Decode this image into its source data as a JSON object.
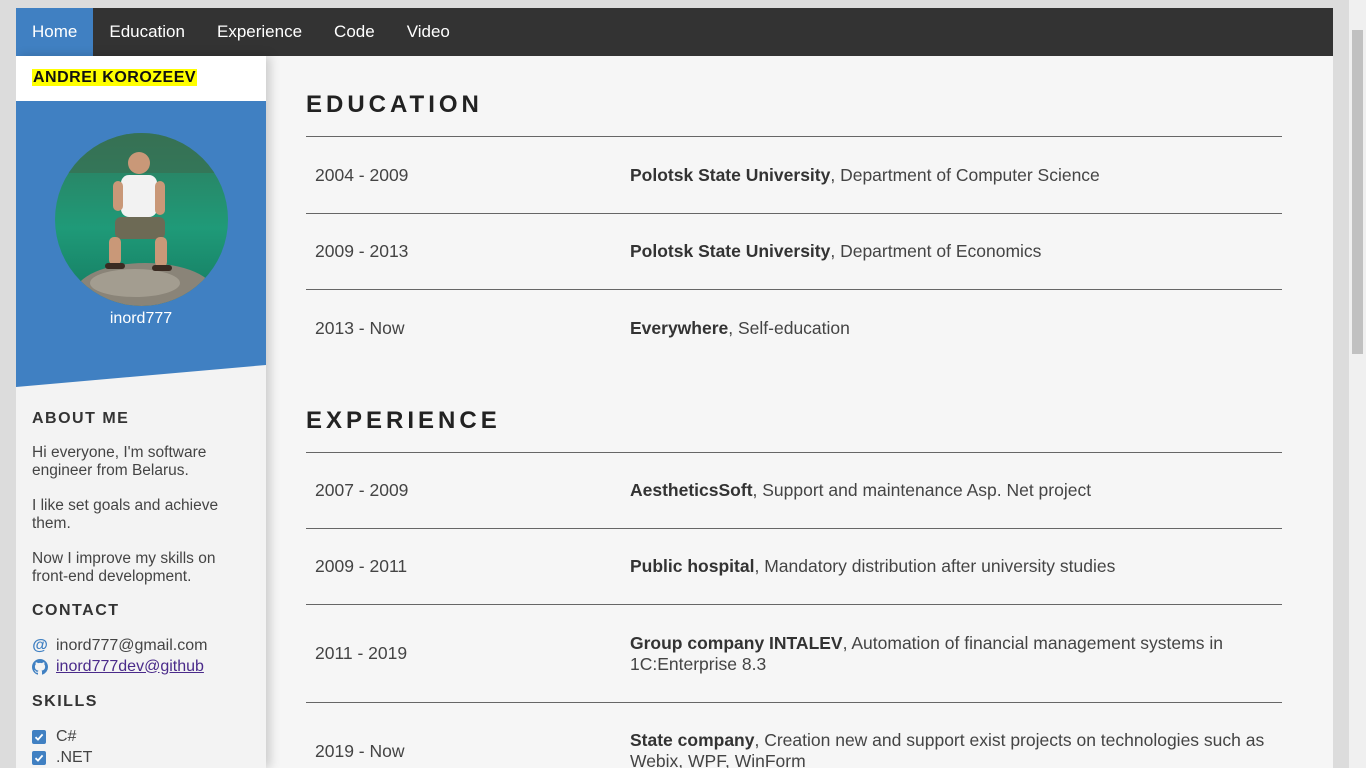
{
  "nav": {
    "items": [
      {
        "label": "Home",
        "active": true
      },
      {
        "label": "Education",
        "active": false
      },
      {
        "label": "Experience",
        "active": false
      },
      {
        "label": "Code",
        "active": false
      },
      {
        "label": "Video",
        "active": false
      }
    ]
  },
  "sidebar": {
    "name": "ANDREI KOROZEEV",
    "username": "inord777",
    "about": {
      "heading": "ABOUT ME",
      "paragraphs": [
        "Hi everyone, I'm software engineer from Belarus.",
        "I like set goals and achieve them.",
        "Now I improve my skills on front-end development."
      ]
    },
    "contact": {
      "heading": "CONTACT",
      "email": "inord777@gmail.com",
      "github": "inord777dev@github",
      "email_icon": "at-icon",
      "github_icon": "github-icon"
    },
    "skills": {
      "heading": "SKILLS",
      "items": [
        "C#",
        ".NET"
      ]
    }
  },
  "education": {
    "heading": "EDUCATION",
    "rows": [
      {
        "years": "2004 - 2009",
        "org": "Polotsk State University",
        "detail": ", Department of Computer Science"
      },
      {
        "years": "2009 - 2013",
        "org": "Polotsk State University",
        "detail": ", Department of Economics"
      },
      {
        "years": "2013 - Now",
        "org": "Everywhere",
        "detail": ", Self-education"
      }
    ]
  },
  "experience": {
    "heading": "EXPERIENCE",
    "rows": [
      {
        "years": "2007 - 2009",
        "org": "AestheticsSoft",
        "detail": ", Support and maintenance Asp. Net project"
      },
      {
        "years": "2009 - 2011",
        "org": "Public hospital",
        "detail": ", Mandatory distribution after university studies"
      },
      {
        "years": "2011 - 2019",
        "org": "Group company INTALEV",
        "detail": ", Automation of financial management systems in 1C:Enterprise 8.3"
      },
      {
        "years": "2019 - Now",
        "org": "State company",
        "detail": ", Creation new and support exist projects on technologies such as Webix, WPF, WinForm"
      }
    ]
  },
  "colors": {
    "nav_bg": "#333333",
    "accent": "#4080c2",
    "name_highlight": "#ffff00",
    "page_bg": "#f6f6f6"
  }
}
